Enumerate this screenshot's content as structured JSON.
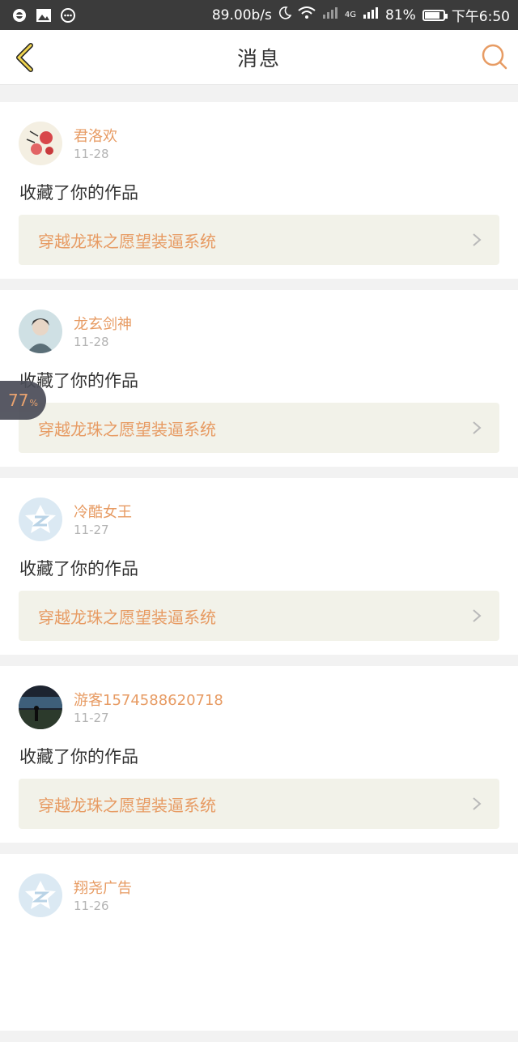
{
  "status_bar": {
    "speed": "89.00b/s",
    "net_type": "4G",
    "battery": "81%",
    "battery_level": 0.81,
    "time": "下午6:50"
  },
  "header": {
    "title": "消息",
    "back_icon": "back-chevron-icon",
    "search_icon": "search-icon"
  },
  "colors": {
    "accent": "#e79b63",
    "work_bg": "#f2f2e9",
    "status_bar": "#3b3b3b"
  },
  "messages": [
    {
      "user": "君洛欢",
      "date": "11-28",
      "action": "收藏了你的作品",
      "work": "穿越龙珠之愿望装逼系统",
      "avatar": "floral-avatar"
    },
    {
      "user": "龙玄剑神",
      "date": "11-28",
      "action": "收藏了你的作品",
      "work": "穿越龙珠之愿望装逼系统",
      "avatar": "anime-avatar"
    },
    {
      "user": "冷酷女王",
      "date": "11-27",
      "action": "收藏了你的作品",
      "work": "穿越龙珠之愿望装逼系统",
      "avatar": "default-avatar"
    },
    {
      "user": "游客1574588620718",
      "date": "11-27",
      "action": "收藏了你的作品",
      "work": "穿越龙珠之愿望装逼系统",
      "avatar": "night-photo-avatar"
    },
    {
      "user": "翔尧广告",
      "date": "11-26",
      "action": "",
      "work": "",
      "avatar": "default-avatar"
    }
  ],
  "float_bubble": {
    "value": "77",
    "unit": "%"
  }
}
